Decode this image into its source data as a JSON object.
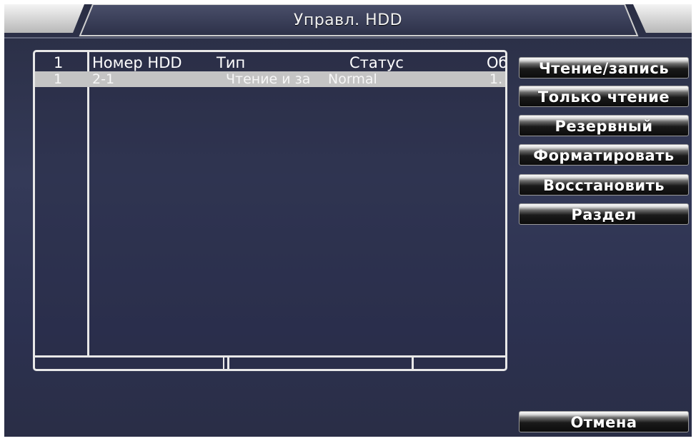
{
  "window": {
    "title": "Управл. HDD"
  },
  "table": {
    "header": {
      "index": "1",
      "number": "Номер HDD",
      "type": "Тип",
      "status": "Статус",
      "extra": "Об"
    },
    "rows": [
      {
        "index": "1",
        "number": "2-1",
        "type": "Чтение и за",
        "status": "Normal",
        "extra": "1."
      }
    ]
  },
  "actions": {
    "read_write": "Чтение/запись",
    "read_only": "Только чтение",
    "backup": "Резервный",
    "format": "Форматировать",
    "recover": "Восстановить",
    "partition": "Раздел",
    "cancel": "Отмена"
  }
}
